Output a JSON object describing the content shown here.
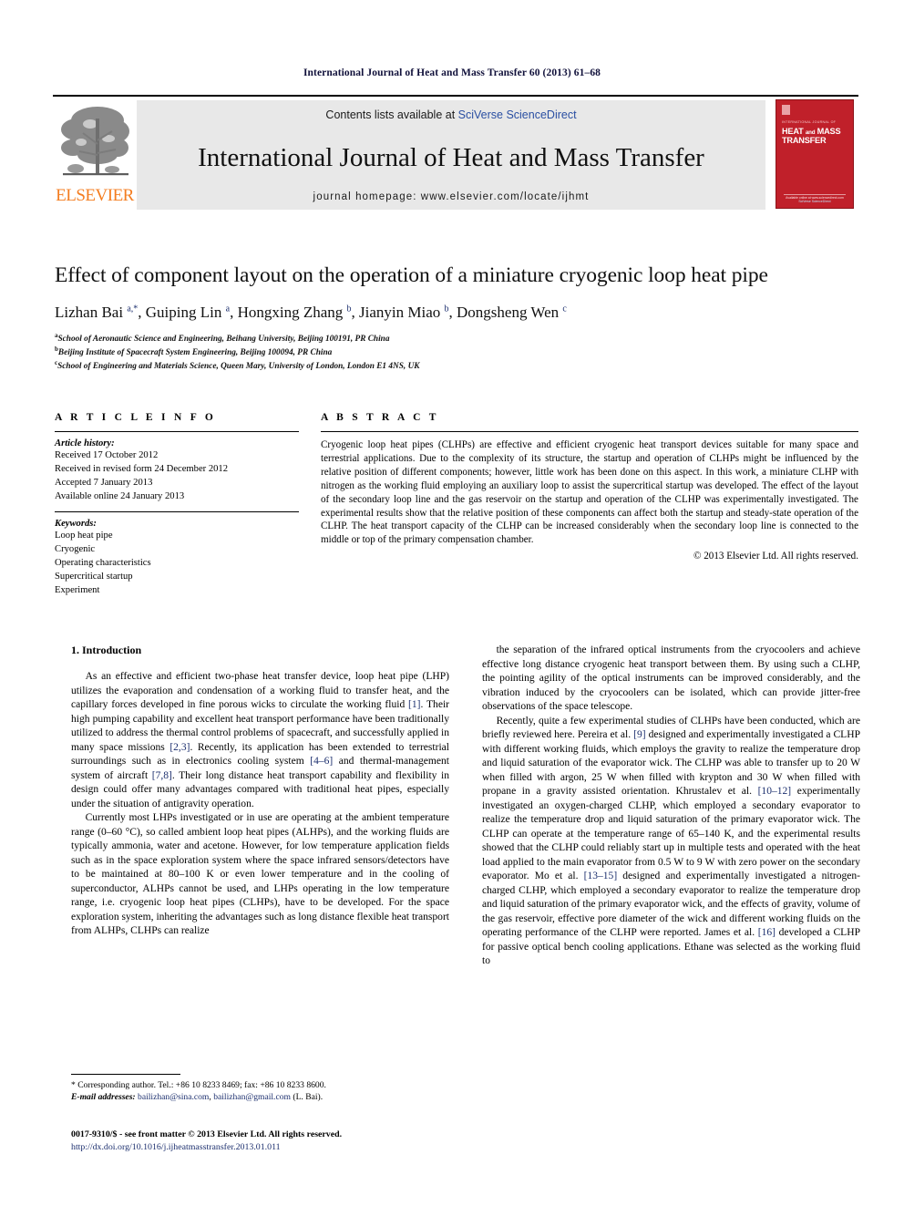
{
  "running_head": "International Journal of Heat and Mass Transfer 60 (2013) 61–68",
  "header": {
    "contents_prefix": "Contents lists available at ",
    "contents_link": "SciVerse ScienceDirect",
    "journal_title": "International Journal of Heat and Mass Transfer",
    "homepage": "journal homepage: www.elsevier.com/locate/ijhmt",
    "publisher_name": "ELSEVIER",
    "cover": {
      "issn_line": "INTERNATIONAL JOURNAL OF",
      "title_line1": "HEAT",
      "title_and": "and",
      "title_line1b": "MASS",
      "title_line2": "TRANSFER",
      "foot_line1": "Available online at www.sciencedirect.com",
      "foot_line2": "SciVerse ScienceDirect"
    },
    "accent_color": "#2a4fa2",
    "cover_color": "#c0202a",
    "elsevier_color": "#f47d20"
  },
  "article": {
    "title": "Effect of component layout on the operation of a miniature cryogenic loop heat pipe",
    "authors_html": "Lizhan Bai <sup>a,*</sup>, Guiping Lin <sup>a</sup>, Hongxing Zhang <sup>b</sup>, Jianyin Miao <sup>b</sup>, Dongsheng Wen <sup>c</sup>",
    "affiliations": [
      {
        "marker": "a",
        "text": "School of Aeronautic Science and Engineering, Beihang University, Beijing 100191, PR China"
      },
      {
        "marker": "b",
        "text": "Beijing Institute of Spacecraft System Engineering, Beijing 100094, PR China"
      },
      {
        "marker": "c",
        "text": "School of Engineering and Materials Science, Queen Mary, University of London, London E1 4NS, UK"
      }
    ]
  },
  "article_info": {
    "heading": "A R T I C L E    I N F O",
    "history_label": "Article history:",
    "history": [
      "Received 17 October 2012",
      "Received in revised form 24 December 2012",
      "Accepted 7 January 2013",
      "Available online 24 January 2013"
    ],
    "keywords_label": "Keywords:",
    "keywords": [
      "Loop heat pipe",
      "Cryogenic",
      "Operating characteristics",
      "Supercritical startup",
      "Experiment"
    ]
  },
  "abstract": {
    "heading": "A B S T R A C T",
    "text": "Cryogenic loop heat pipes (CLHPs) are effective and efficient cryogenic heat transport devices suitable for many space and terrestrial applications. Due to the complexity of its structure, the startup and operation of CLHPs might be influenced by the relative position of different components; however, little work has been done on this aspect. In this work, a miniature CLHP with nitrogen as the working fluid employing an auxiliary loop to assist the supercritical startup was developed. The effect of the layout of the secondary loop line and the gas reservoir on the startup and operation of the CLHP was experimentally investigated. The experimental results show that the relative position of these components can affect both the startup and steady-state operation of the CLHP. The heat transport capacity of the CLHP can be increased considerably when the secondary loop line is connected to the middle or top of the primary compensation chamber.",
    "copyright": "© 2013 Elsevier Ltd. All rights reserved."
  },
  "body": {
    "section_title": "1. Introduction",
    "left_paragraphs": [
      "As an effective and efficient two-phase heat transfer device, loop heat pipe (LHP) utilizes the evaporation and condensation of a working fluid to transfer heat, and the capillary forces developed in fine porous wicks to circulate the working fluid [1]. Their high pumping capability and excellent heat transport performance have been traditionally utilized to address the thermal control problems of spacecraft, and successfully applied in many space missions [2,3]. Recently, its application has been extended to terrestrial surroundings such as in electronics cooling system [4–6] and thermal-management system of aircraft [7,8]. Their long distance heat transport capability and flexibility in design could offer many advantages compared with traditional heat pipes, especially under the situation of antigravity operation.",
      "Currently most LHPs investigated or in use are operating at the ambient temperature range (0–60 °C), so called ambient loop heat pipes (ALHPs), and the working fluids are typically ammonia, water and acetone. However, for low temperature application fields such as in the space exploration system where the space infrared sensors/detectors have to be maintained at 80–100 K or even lower temperature and in the cooling of superconductor, ALHPs cannot be used, and LHPs operating in the low temperature range, i.e. cryogenic loop heat pipes (CLHPs), have to be developed. For the space exploration system, inheriting the advantages such as long distance flexible heat transport from ALHPs, CLHPs can realize"
    ],
    "right_paragraphs": [
      "the separation of the infrared optical instruments from the cryocoolers and achieve effective long distance cryogenic heat transport between them. By using such a CLHP, the pointing agility of the optical instruments can be improved considerably, and the vibration induced by the cryocoolers can be isolated, which can provide jitter-free observations of the space telescope.",
      "Recently, quite a few experimental studies of CLHPs have been conducted, which are briefly reviewed here. Pereira et al. [9] designed and experimentally investigated a CLHP with different working fluids, which employs the gravity to realize the temperature drop and liquid saturation of the evaporator wick. The CLHP was able to transfer up to 20 W when filled with argon, 25 W when filled with krypton and 30 W when filled with propane in a gravity assisted orientation. Khrustalev et al. [10–12] experimentally investigated an oxygen-charged CLHP, which employed a secondary evaporator to realize the temperature drop and liquid saturation of the primary evaporator wick. The CLHP can operate at the temperature range of 65–140 K, and the experimental results showed that the CLHP could reliably start up in multiple tests and operated with the heat load applied to the main evaporator from 0.5 W to 9 W with zero power on the secondary evaporator. Mo et al. [13–15] designed and experimentally investigated a nitrogen-charged CLHP, which employed a secondary evaporator to realize the temperature drop and liquid saturation of the primary evaporator wick, and the effects of gravity, volume of the gas reservoir, effective pore diameter of the wick and different working fluids on the operating performance of the CLHP were reported. James et al. [16] developed a CLHP for passive optical bench cooling applications. Ethane was selected as the working fluid to"
    ]
  },
  "footnote": {
    "corresponding": "* Corresponding author. Tel.: +86 10 8233 8469; fax: +86 10 8233 8600.",
    "email_label": "E-mail addresses:",
    "email1": "bailizhan@sina.com",
    "email2": "bailizhan@gmail.com",
    "email_suffix": "(L. Bai)."
  },
  "bottom": {
    "front_matter": "0017-9310/$ - see front matter © 2013 Elsevier Ltd. All rights reserved.",
    "doi": "http://dx.doi.org/10.1016/j.ijheatmasstransfer.2013.01.011"
  }
}
